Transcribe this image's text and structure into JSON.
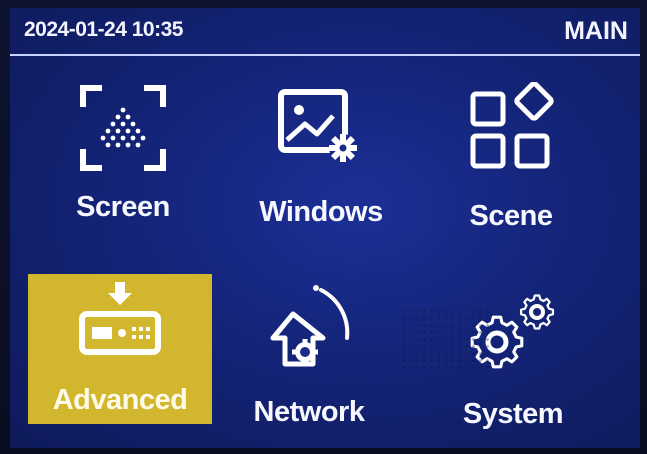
{
  "status_bar": {
    "datetime": "2024-01-24 10:35",
    "title": "MAIN"
  },
  "menu": {
    "items": [
      {
        "label": "Screen",
        "icon": "screen-icon",
        "selected": false
      },
      {
        "label": "Windows",
        "icon": "windows-icon",
        "selected": false
      },
      {
        "label": "Scene",
        "icon": "scene-icon",
        "selected": false
      },
      {
        "label": "Advanced",
        "icon": "advanced-icon",
        "selected": true
      },
      {
        "label": "Network",
        "icon": "network-icon",
        "selected": false
      },
      {
        "label": "System",
        "icon": "system-icon",
        "selected": false
      }
    ]
  },
  "colors": {
    "background": "#1a2a8a",
    "selected_tile": "#d2b62e",
    "text": "#ffffff"
  }
}
